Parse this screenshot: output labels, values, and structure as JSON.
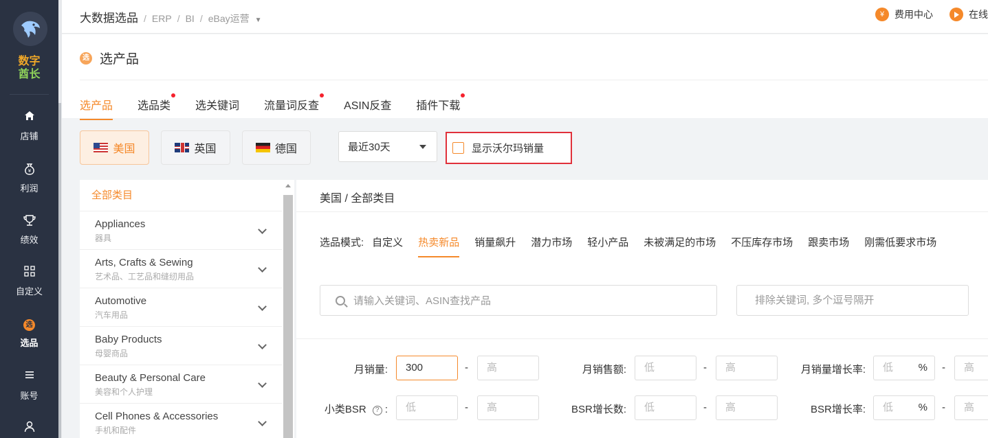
{
  "sidebar": {
    "brand_line1": "数字",
    "brand_line2": "酋长",
    "items": [
      {
        "label": "店铺",
        "icon": "home-icon"
      },
      {
        "label": "利润",
        "icon": "money-bag-icon"
      },
      {
        "label": "绩效",
        "icon": "trophy-icon"
      },
      {
        "label": "自定义",
        "icon": "grid-icon"
      },
      {
        "label": "选品",
        "icon": "select-product-icon",
        "icon_text": "选",
        "active": true
      },
      {
        "label": "账号",
        "icon": "menu-icon"
      },
      {
        "label": "",
        "icon": "user-icon"
      }
    ]
  },
  "topbar": {
    "breadcrumb": [
      "大数据选品",
      "ERP",
      "BI",
      "eBay运营"
    ],
    "fee_center": "费用中心",
    "fee_icon_text": "¥",
    "online": "在线"
  },
  "page": {
    "title": "选产品",
    "title_icon_text": "选",
    "tabs": [
      {
        "label": "选产品",
        "active": true,
        "dot": false
      },
      {
        "label": "选品类",
        "active": false,
        "dot": true
      },
      {
        "label": "选关键词",
        "active": false,
        "dot": false
      },
      {
        "label": "流量词反查",
        "active": false,
        "dot": true
      },
      {
        "label": "ASIN反查",
        "active": false,
        "dot": false
      },
      {
        "label": "插件下载",
        "active": false,
        "dot": true
      }
    ]
  },
  "filters": {
    "countries": [
      {
        "label": "美国",
        "flag": "us",
        "active": true
      },
      {
        "label": "英国",
        "flag": "uk",
        "active": false
      },
      {
        "label": "德国",
        "flag": "de",
        "active": false
      }
    ],
    "period": "最近30天",
    "walmart_label": "显示沃尔玛销量",
    "walmart_checked": false
  },
  "categories": {
    "header": "全部类目",
    "items": [
      {
        "en": "Appliances",
        "zh": "器具"
      },
      {
        "en": "Arts, Crafts & Sewing",
        "zh": "艺术品、工艺品和缝纫用品"
      },
      {
        "en": "Automotive",
        "zh": "汽车用品"
      },
      {
        "en": "Baby Products",
        "zh": "母婴商品"
      },
      {
        "en": "Beauty & Personal Care",
        "zh": "美容和个人护理"
      },
      {
        "en": "Cell Phones & Accessories",
        "zh": "手机和配件"
      }
    ]
  },
  "main": {
    "breadcrumb": "美国 / 全部类目",
    "mode_label": "选品模式:",
    "modes": [
      "自定义",
      "热卖新品",
      "销量飙升",
      "潜力市场",
      "轻小产品",
      "未被满足的市场",
      "不压库存市场",
      "跟卖市场",
      "刚需低要求市场"
    ],
    "active_mode": 1,
    "search_placeholder": "请输入关键词、ASIN查找产品",
    "exclude_placeholder": "排除关键词, 多个逗号隔开",
    "range_sep": "-",
    "low": "低",
    "high": "高",
    "percent": "%",
    "fields": {
      "monthly_sales": {
        "label": "月销量:",
        "min": "300",
        "max_placeholder": "高"
      },
      "monthly_revenue": {
        "label": "月销售额:",
        "min_placeholder": "低",
        "max_placeholder": "高"
      },
      "sales_growth": {
        "label": "月销量增长率:",
        "min_placeholder": "低",
        "max_placeholder": "高"
      },
      "sub_bsr": {
        "label": "小类BSR",
        "suffix": ":",
        "min_placeholder": "低",
        "max_placeholder": "高"
      },
      "bsr_growth_count": {
        "label": "BSR增长数:",
        "min_placeholder": "低",
        "max_placeholder": "高"
      },
      "bsr_growth_rate": {
        "label": "BSR增长率:",
        "min_placeholder": "低",
        "max_placeholder": "高"
      }
    }
  },
  "colors": {
    "accent": "#f5892a",
    "sidebar": "#2a3242",
    "highlight_border": "#e0303a"
  }
}
